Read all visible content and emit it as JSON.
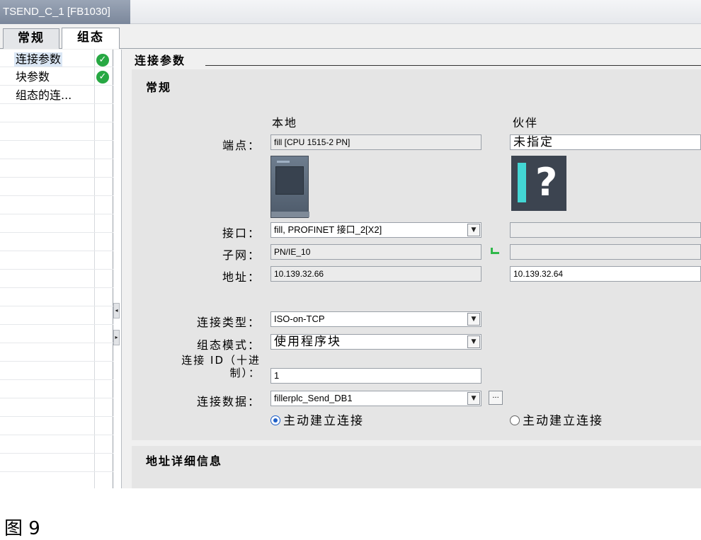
{
  "window": {
    "title": "TSEND_C_1 [FB1030]"
  },
  "tabs": [
    {
      "label": "常规"
    },
    {
      "label": "组态"
    }
  ],
  "sidebar": {
    "items": [
      {
        "label": "连接参数"
      },
      {
        "label": "块参数"
      },
      {
        "label": "组态的连..."
      }
    ]
  },
  "main": {
    "section_title": "连接参数",
    "general": {
      "title": "常规",
      "col_local": "本地",
      "col_partner": "伙伴",
      "endpoint": {
        "label": "端点：",
        "local": "fill [CPU 1515-2 PN]",
        "partner": "未指定"
      },
      "interface": {
        "label": "接口：",
        "local": "fill, PROFINET 接口_2[X2]",
        "partner": ""
      },
      "subnet": {
        "label": "子网：",
        "local": "PN/IE_10",
        "partner": ""
      },
      "address": {
        "label": "地址：",
        "local": "10.139.32.66",
        "partner": "10.139.32.64"
      },
      "connection_type": {
        "label": "连接类型：",
        "value": "ISO-on-TCP"
      },
      "config_mode": {
        "label": "组态模式：",
        "value": "使用程序块"
      },
      "connection_id": {
        "label_line1": "连接 ID（十进",
        "label_line2": "制）：",
        "value": "1"
      },
      "connection_data": {
        "label": "连接数据：",
        "value": "fillerplc_Send_DB1",
        "browse_label": "..."
      },
      "radio_local": {
        "label": "主动建立连接",
        "selected": true
      },
      "radio_partner": {
        "label": "主动建立连接",
        "selected": false
      }
    },
    "address_details": {
      "title": "地址详细信息"
    }
  },
  "caption": "图 9",
  "colors": {
    "title_tab_bg": "#8592a6",
    "panel_bg": "#e5e5e5",
    "check_green": "#27a843",
    "radio_blue": "#1e5fc7",
    "plc_cyan": "#43d6d4"
  }
}
